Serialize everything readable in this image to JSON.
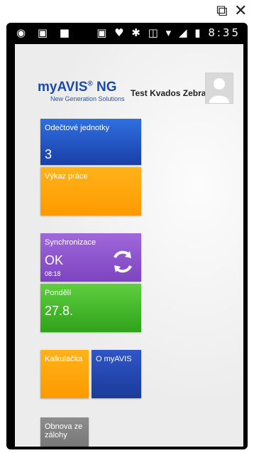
{
  "window_controls": {
    "popout": "⧉",
    "close": "✕"
  },
  "status_bar": {
    "left_icons": "◉ ▣ ■",
    "right_icons": "▣ ♥ ✱ ◫ ▾ ◢ ▮",
    "time": "8:35"
  },
  "header": {
    "logo": "myAVIS",
    "logo_reg": "®",
    "logo_ng": " NG",
    "logo_sub": "New Generation Solutions",
    "user_name": "Test Kvados Zebra"
  },
  "tiles": {
    "units": {
      "title": "Odečtové jednotky",
      "value": "3"
    },
    "work": {
      "title": "Výkaz práce"
    },
    "sync": {
      "title": "Synchronizace",
      "value": "OK",
      "time": "08:18"
    },
    "day": {
      "title": "Pondělí",
      "value": "27.8."
    },
    "calc": {
      "title": "Kalkulačka"
    },
    "about": {
      "title": "O myAVIS"
    },
    "restore": {
      "title": "Obnova ze zálohy"
    }
  },
  "colors": {
    "blue": "#2f6fe0",
    "orange": "#ffa300",
    "purple": "#8d55cc",
    "green": "#3bb322",
    "gray": "#7d7d7d"
  }
}
